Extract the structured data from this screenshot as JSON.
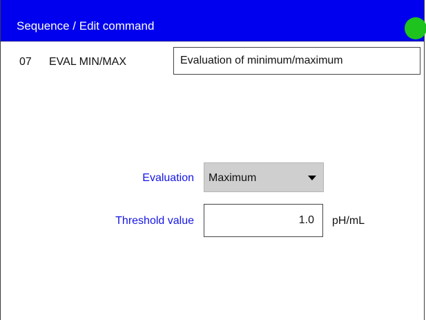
{
  "header": {
    "title": "Sequence / Edit command",
    "status_led_color": "#1ec31e"
  },
  "command": {
    "number": "07",
    "name": "EVAL MIN/MAX",
    "description": "Evaluation of minimum/maximum"
  },
  "evaluation": {
    "label": "Evaluation",
    "value": "Maximum"
  },
  "threshold": {
    "label": "Threshold value",
    "value": "1.0",
    "unit": "pH/mL"
  },
  "colors": {
    "titlebar_bg": "#0000ee",
    "label_blue": "#1414e6",
    "select_bg": "#cfcfcf"
  }
}
